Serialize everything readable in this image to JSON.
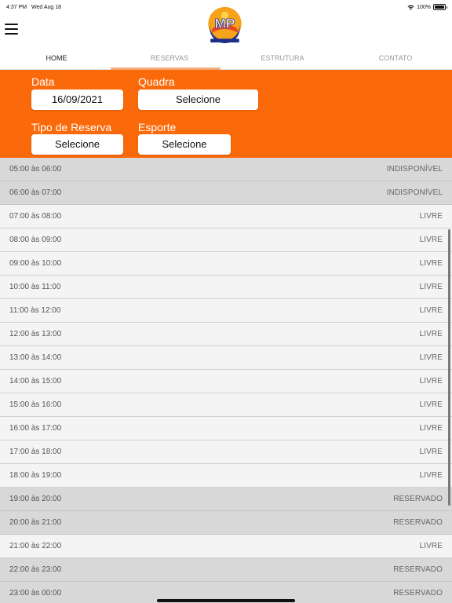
{
  "status_bar": {
    "time": "4:37 PM",
    "date": "Wed Aug 18",
    "battery": "100%"
  },
  "nav": {
    "tabs": [
      {
        "label": "HOME"
      },
      {
        "label": "RESERVAS"
      },
      {
        "label": "ESTRUTURA"
      },
      {
        "label": "CONTATO"
      }
    ]
  },
  "filters": {
    "data_label": "Data",
    "data_value": "16/09/2021",
    "quadra_label": "Quadra",
    "quadra_value": "Selecione",
    "tipo_label": "Tipo de Reserva",
    "tipo_value": "Selecione",
    "esporte_label": "Esporte",
    "esporte_value": "Selecione"
  },
  "colors": {
    "accent": "#fa6a0a",
    "unavailable_row": "#d8d8d8",
    "free_row": "#f4f4f4"
  },
  "slots": [
    {
      "time": "05:00 às 06:00",
      "status": "INDISPONÍVEL"
    },
    {
      "time": "06:00 às 07:00",
      "status": "INDISPONÍVEL"
    },
    {
      "time": "07:00 às 08:00",
      "status": "LIVRE"
    },
    {
      "time": "08:00 às 09:00",
      "status": "LIVRE"
    },
    {
      "time": "09:00 às 10:00",
      "status": "LIVRE"
    },
    {
      "time": "10:00 às 11:00",
      "status": "LIVRE"
    },
    {
      "time": "11:00 às 12:00",
      "status": "LIVRE"
    },
    {
      "time": "12:00 às 13:00",
      "status": "LIVRE"
    },
    {
      "time": "13:00 às 14:00",
      "status": "LIVRE"
    },
    {
      "time": "14:00 às 15:00",
      "status": "LIVRE"
    },
    {
      "time": "15:00 às 16:00",
      "status": "LIVRE"
    },
    {
      "time": "16:00 às 17:00",
      "status": "LIVRE"
    },
    {
      "time": "17:00 às 18:00",
      "status": "LIVRE"
    },
    {
      "time": "18:00 às 19:00",
      "status": "LIVRE"
    },
    {
      "time": "19:00 às 20:00",
      "status": "RESERVADO"
    },
    {
      "time": "20:00 às 21:00",
      "status": "RESERVADO"
    },
    {
      "time": "21:00 às 22:00",
      "status": "LIVRE"
    },
    {
      "time": "22:00 às 23:00",
      "status": "RESERVADO"
    },
    {
      "time": "23:00 às 00:00",
      "status": "RESERVADO"
    }
  ]
}
